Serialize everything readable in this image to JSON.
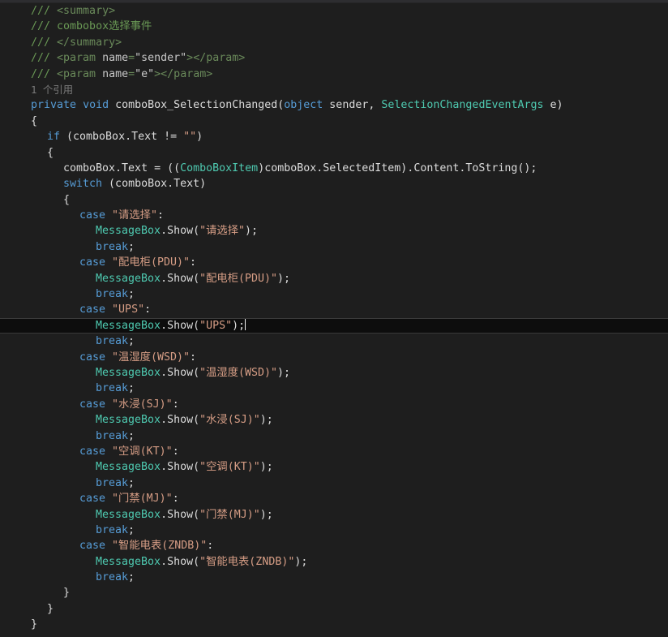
{
  "window": {
    "app": "visual-studio-code-editor",
    "theme_name": "dark",
    "background_color": "#1e1e1e",
    "current_line_background": "#0d0d0d",
    "current_line_border": "#3a3a3a",
    "top_strip_color": "#2d2d30"
  },
  "palette": {
    "comment": "#57a64a",
    "xml_doc_comment": "#6a9955",
    "xml_doc_tag": "#6a8a5a",
    "keyword": "#569cd6",
    "type": "#4ec9b0",
    "string": "#d69d85",
    "plain_text": "#dcdcdc",
    "codelens": "#7a7a7a",
    "caret": "#f0f0f0"
  },
  "codelens": {
    "text": "1 个引用",
    "references_count": "1"
  },
  "editor": {
    "language": "C#",
    "caret_line_index": 19,
    "caret_after_text": "MessageBox.Show(\"UPS\");",
    "lines": [
      {
        "indent": 1,
        "tokens": [
          {
            "text": "/// ",
            "cls": "tok-xmldoc"
          },
          {
            "text": "<summary>",
            "cls": "tok-xmltag"
          }
        ]
      },
      {
        "indent": 1,
        "tokens": [
          {
            "text": "/// ",
            "cls": "tok-xmldoc"
          },
          {
            "text": "combobox选择事件",
            "cls": "tok-xmldoc"
          }
        ]
      },
      {
        "indent": 1,
        "tokens": [
          {
            "text": "/// ",
            "cls": "tok-xmldoc"
          },
          {
            "text": "</summary>",
            "cls": "tok-xmltag"
          }
        ]
      },
      {
        "indent": 1,
        "tokens": [
          {
            "text": "/// ",
            "cls": "tok-xmldoc"
          },
          {
            "text": "<param ",
            "cls": "tok-xmltag"
          },
          {
            "text": "name",
            "cls": "tok-xmlattr"
          },
          {
            "text": "=",
            "cls": "tok-xmltag"
          },
          {
            "text": "\"sender\"",
            "cls": "tok-xmlval"
          },
          {
            "text": ">",
            "cls": "tok-xmltag"
          },
          {
            "text": "</param>",
            "cls": "tok-xmltag"
          }
        ]
      },
      {
        "indent": 1,
        "tokens": [
          {
            "text": "/// ",
            "cls": "tok-xmldoc"
          },
          {
            "text": "<param ",
            "cls": "tok-xmltag"
          },
          {
            "text": "name",
            "cls": "tok-xmlattr"
          },
          {
            "text": "=",
            "cls": "tok-xmltag"
          },
          {
            "text": "\"e\"",
            "cls": "tok-xmlval"
          },
          {
            "text": ">",
            "cls": "tok-xmltag"
          },
          {
            "text": "</param>",
            "cls": "tok-xmltag"
          }
        ]
      },
      {
        "indent": 1,
        "codelens": true,
        "tokens": [
          {
            "text": "1 个引用",
            "cls": "tok-codelens"
          }
        ]
      },
      {
        "indent": 1,
        "tokens": [
          {
            "text": "private",
            "cls": "tok-keyword"
          },
          {
            "text": " ",
            "cls": "tok-plain"
          },
          {
            "text": "void",
            "cls": "tok-keyword"
          },
          {
            "text": " comboBox_SelectionChanged(",
            "cls": "tok-plain"
          },
          {
            "text": "object",
            "cls": "tok-keyword"
          },
          {
            "text": " sender, ",
            "cls": "tok-plain"
          },
          {
            "text": "SelectionChangedEventArgs",
            "cls": "tok-type"
          },
          {
            "text": " e)",
            "cls": "tok-plain"
          }
        ]
      },
      {
        "indent": 1,
        "tokens": [
          {
            "text": "{",
            "cls": "tok-plain"
          }
        ]
      },
      {
        "indent": 2,
        "tokens": [
          {
            "text": "if",
            "cls": "tok-keyword"
          },
          {
            "text": " (comboBox.Text != ",
            "cls": "tok-plain"
          },
          {
            "text": "\"\"",
            "cls": "tok-string"
          },
          {
            "text": ")",
            "cls": "tok-plain"
          }
        ]
      },
      {
        "indent": 2,
        "tokens": [
          {
            "text": "{",
            "cls": "tok-plain"
          }
        ]
      },
      {
        "indent": 3,
        "tokens": [
          {
            "text": "comboBox.Text = ((",
            "cls": "tok-plain"
          },
          {
            "text": "ComboBoxItem",
            "cls": "tok-type"
          },
          {
            "text": ")comboBox.SelectedItem).Content.ToString();",
            "cls": "tok-plain"
          }
        ]
      },
      {
        "indent": 3,
        "tokens": [
          {
            "text": "switch",
            "cls": "tok-keyword"
          },
          {
            "text": " (comboBox.Text)",
            "cls": "tok-plain"
          }
        ]
      },
      {
        "indent": 3,
        "tokens": [
          {
            "text": "{",
            "cls": "tok-plain"
          }
        ]
      },
      {
        "indent": 4,
        "tokens": [
          {
            "text": "case",
            "cls": "tok-keyword"
          },
          {
            "text": " ",
            "cls": "tok-plain"
          },
          {
            "text": "\"请选择\"",
            "cls": "tok-string"
          },
          {
            "text": ":",
            "cls": "tok-plain"
          }
        ]
      },
      {
        "indent": 5,
        "tokens": [
          {
            "text": "MessageBox",
            "cls": "tok-type"
          },
          {
            "text": ".Show(",
            "cls": "tok-plain"
          },
          {
            "text": "\"请选择\"",
            "cls": "tok-string"
          },
          {
            "text": ");",
            "cls": "tok-plain"
          }
        ]
      },
      {
        "indent": 5,
        "tokens": [
          {
            "text": "break",
            "cls": "tok-keyword"
          },
          {
            "text": ";",
            "cls": "tok-plain"
          }
        ]
      },
      {
        "indent": 4,
        "tokens": [
          {
            "text": "case",
            "cls": "tok-keyword"
          },
          {
            "text": " ",
            "cls": "tok-plain"
          },
          {
            "text": "\"配电柜(PDU)\"",
            "cls": "tok-string"
          },
          {
            "text": ":",
            "cls": "tok-plain"
          }
        ]
      },
      {
        "indent": 5,
        "tokens": [
          {
            "text": "MessageBox",
            "cls": "tok-type"
          },
          {
            "text": ".Show(",
            "cls": "tok-plain"
          },
          {
            "text": "\"配电柜(PDU)\"",
            "cls": "tok-string"
          },
          {
            "text": ");",
            "cls": "tok-plain"
          }
        ]
      },
      {
        "indent": 5,
        "tokens": [
          {
            "text": "break",
            "cls": "tok-keyword"
          },
          {
            "text": ";",
            "cls": "tok-plain"
          }
        ]
      },
      {
        "indent": 4,
        "tokens": [
          {
            "text": "case",
            "cls": "tok-keyword"
          },
          {
            "text": " ",
            "cls": "tok-plain"
          },
          {
            "text": "\"UPS\"",
            "cls": "tok-string"
          },
          {
            "text": ":",
            "cls": "tok-plain"
          }
        ]
      },
      {
        "indent": 5,
        "current": true,
        "caret": true,
        "tokens": [
          {
            "text": "MessageBox",
            "cls": "tok-type"
          },
          {
            "text": ".Show(",
            "cls": "tok-plain"
          },
          {
            "text": "\"UPS\"",
            "cls": "tok-string"
          },
          {
            "text": ");",
            "cls": "tok-plain"
          }
        ]
      },
      {
        "indent": 5,
        "tokens": [
          {
            "text": "break",
            "cls": "tok-keyword"
          },
          {
            "text": ";",
            "cls": "tok-plain"
          }
        ]
      },
      {
        "indent": 4,
        "tokens": [
          {
            "text": "case",
            "cls": "tok-keyword"
          },
          {
            "text": " ",
            "cls": "tok-plain"
          },
          {
            "text": "\"温湿度(WSD)\"",
            "cls": "tok-string"
          },
          {
            "text": ":",
            "cls": "tok-plain"
          }
        ]
      },
      {
        "indent": 5,
        "tokens": [
          {
            "text": "MessageBox",
            "cls": "tok-type"
          },
          {
            "text": ".Show(",
            "cls": "tok-plain"
          },
          {
            "text": "\"温湿度(WSD)\"",
            "cls": "tok-string"
          },
          {
            "text": ");",
            "cls": "tok-plain"
          }
        ]
      },
      {
        "indent": 5,
        "tokens": [
          {
            "text": "break",
            "cls": "tok-keyword"
          },
          {
            "text": ";",
            "cls": "tok-plain"
          }
        ]
      },
      {
        "indent": 4,
        "tokens": [
          {
            "text": "case",
            "cls": "tok-keyword"
          },
          {
            "text": " ",
            "cls": "tok-plain"
          },
          {
            "text": "\"水浸(SJ)\"",
            "cls": "tok-string"
          },
          {
            "text": ":",
            "cls": "tok-plain"
          }
        ]
      },
      {
        "indent": 5,
        "tokens": [
          {
            "text": "MessageBox",
            "cls": "tok-type"
          },
          {
            "text": ".Show(",
            "cls": "tok-plain"
          },
          {
            "text": "\"水浸(SJ)\"",
            "cls": "tok-string"
          },
          {
            "text": ");",
            "cls": "tok-plain"
          }
        ]
      },
      {
        "indent": 5,
        "tokens": [
          {
            "text": "break",
            "cls": "tok-keyword"
          },
          {
            "text": ";",
            "cls": "tok-plain"
          }
        ]
      },
      {
        "indent": 4,
        "tokens": [
          {
            "text": "case",
            "cls": "tok-keyword"
          },
          {
            "text": " ",
            "cls": "tok-plain"
          },
          {
            "text": "\"空调(KT)\"",
            "cls": "tok-string"
          },
          {
            "text": ":",
            "cls": "tok-plain"
          }
        ]
      },
      {
        "indent": 5,
        "tokens": [
          {
            "text": "MessageBox",
            "cls": "tok-type"
          },
          {
            "text": ".Show(",
            "cls": "tok-plain"
          },
          {
            "text": "\"空调(KT)\"",
            "cls": "tok-string"
          },
          {
            "text": ");",
            "cls": "tok-plain"
          }
        ]
      },
      {
        "indent": 5,
        "tokens": [
          {
            "text": "break",
            "cls": "tok-keyword"
          },
          {
            "text": ";",
            "cls": "tok-plain"
          }
        ]
      },
      {
        "indent": 4,
        "tokens": [
          {
            "text": "case",
            "cls": "tok-keyword"
          },
          {
            "text": " ",
            "cls": "tok-plain"
          },
          {
            "text": "\"门禁(MJ)\"",
            "cls": "tok-string"
          },
          {
            "text": ":",
            "cls": "tok-plain"
          }
        ]
      },
      {
        "indent": 5,
        "tokens": [
          {
            "text": "MessageBox",
            "cls": "tok-type"
          },
          {
            "text": ".Show(",
            "cls": "tok-plain"
          },
          {
            "text": "\"门禁(MJ)\"",
            "cls": "tok-string"
          },
          {
            "text": ");",
            "cls": "tok-plain"
          }
        ]
      },
      {
        "indent": 5,
        "tokens": [
          {
            "text": "break",
            "cls": "tok-keyword"
          },
          {
            "text": ";",
            "cls": "tok-plain"
          }
        ]
      },
      {
        "indent": 4,
        "tokens": [
          {
            "text": "case",
            "cls": "tok-keyword"
          },
          {
            "text": " ",
            "cls": "tok-plain"
          },
          {
            "text": "\"智能电表(ZNDB)\"",
            "cls": "tok-string"
          },
          {
            "text": ":",
            "cls": "tok-plain"
          }
        ]
      },
      {
        "indent": 5,
        "tokens": [
          {
            "text": "MessageBox",
            "cls": "tok-type"
          },
          {
            "text": ".Show(",
            "cls": "tok-plain"
          },
          {
            "text": "\"智能电表(ZNDB)\"",
            "cls": "tok-string"
          },
          {
            "text": ");",
            "cls": "tok-plain"
          }
        ]
      },
      {
        "indent": 5,
        "tokens": [
          {
            "text": "break",
            "cls": "tok-keyword"
          },
          {
            "text": ";",
            "cls": "tok-plain"
          }
        ]
      },
      {
        "indent": 3,
        "tokens": [
          {
            "text": "}",
            "cls": "tok-plain"
          }
        ]
      },
      {
        "indent": 2,
        "tokens": [
          {
            "text": "}",
            "cls": "tok-plain"
          }
        ]
      },
      {
        "indent": 1,
        "tokens": [
          {
            "text": "}",
            "cls": "tok-plain"
          }
        ]
      }
    ]
  }
}
